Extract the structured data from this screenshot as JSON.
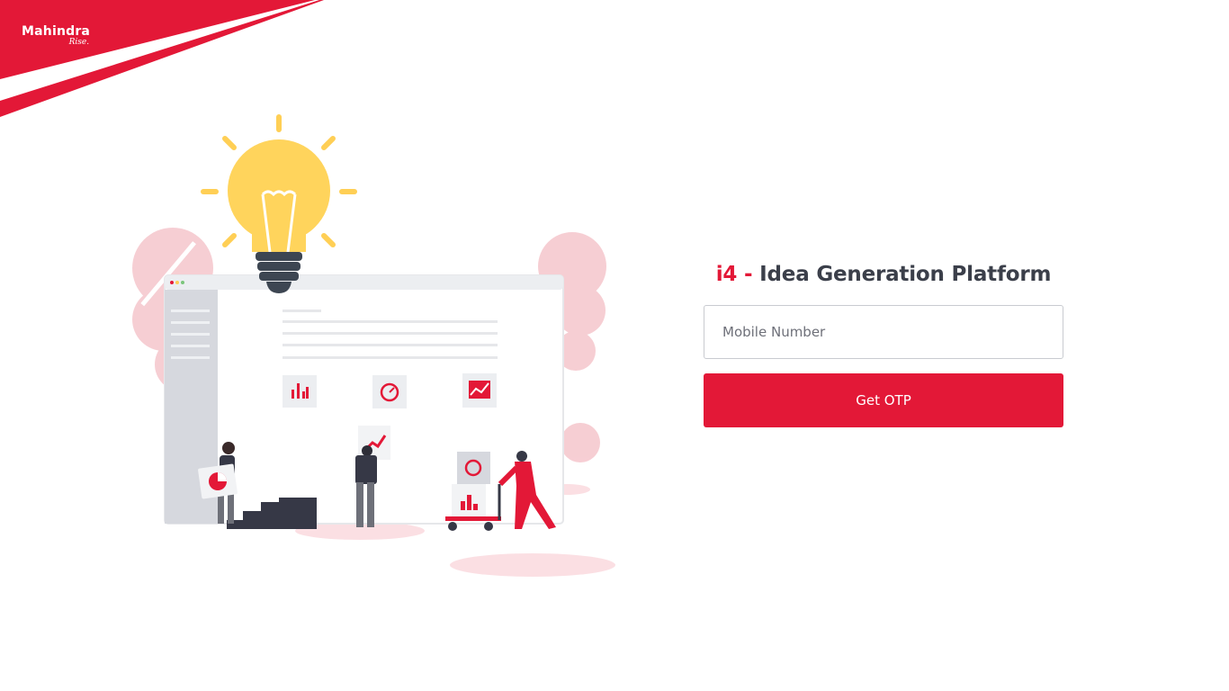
{
  "brand": {
    "name": "Mahindra",
    "tagline": "Rise.",
    "color": "#e31837"
  },
  "login": {
    "title_prefix": "i4 -",
    "title_main": "Idea Generation Platform",
    "mobile_placeholder": "Mobile Number",
    "mobile_value": "",
    "submit_label": "Get OTP"
  },
  "illustration": {
    "subject": "lightbulb-over-dashboard-with-people"
  }
}
